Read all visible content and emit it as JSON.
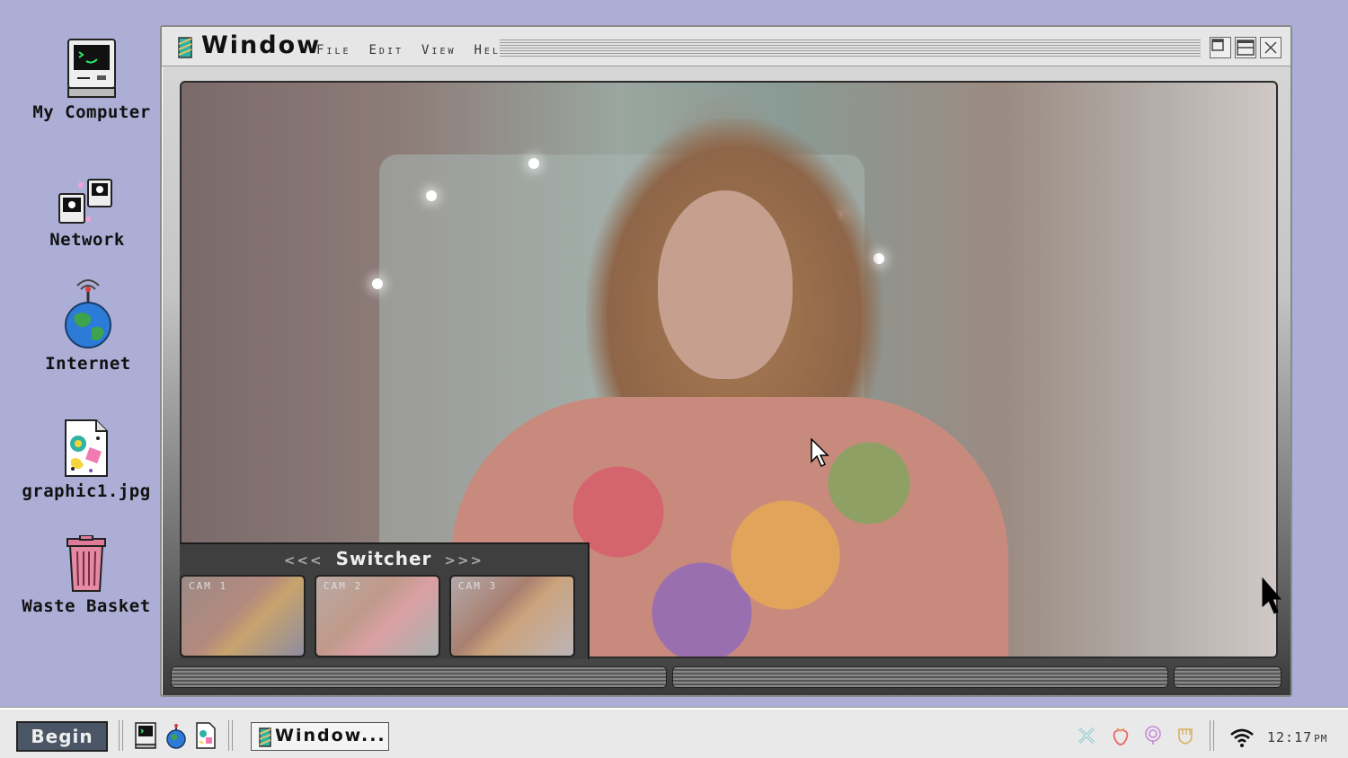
{
  "desktop": {
    "icons": [
      {
        "label": "My Computer",
        "icon": "computer-icon"
      },
      {
        "label": "Network",
        "icon": "network-icon"
      },
      {
        "label": "Internet",
        "icon": "globe-antenna-icon"
      },
      {
        "label": "graphic1.jpg",
        "icon": "image-file-icon"
      },
      {
        "label": "Waste Basket",
        "icon": "trash-icon"
      }
    ]
  },
  "window": {
    "title": "Window",
    "menu": [
      "File",
      "Edit",
      "View",
      "Help"
    ],
    "controls": [
      "minimize",
      "maximize",
      "close"
    ],
    "switcher": {
      "title": "Switcher",
      "prev_arrows": "<<<",
      "next_arrows": ">>>",
      "cams": [
        {
          "label": "CAM 1"
        },
        {
          "label": "CAM 2"
        },
        {
          "label": "CAM 3"
        }
      ]
    }
  },
  "taskbar": {
    "begin_label": "Begin",
    "quick_launch": [
      "computer-icon",
      "globe-icon",
      "image-file-icon"
    ],
    "task_label": "Window...",
    "tray": [
      "close-x-icon",
      "strawberry-icon",
      "target-icon",
      "fist-icon",
      "wifi-icon"
    ],
    "clock_time": "12:17",
    "clock_ampm": "PM"
  },
  "colors": {
    "desktop_bg": "#adaed6",
    "begin_bg": "#4a5566",
    "accent_teal": "#2fb3a4"
  }
}
